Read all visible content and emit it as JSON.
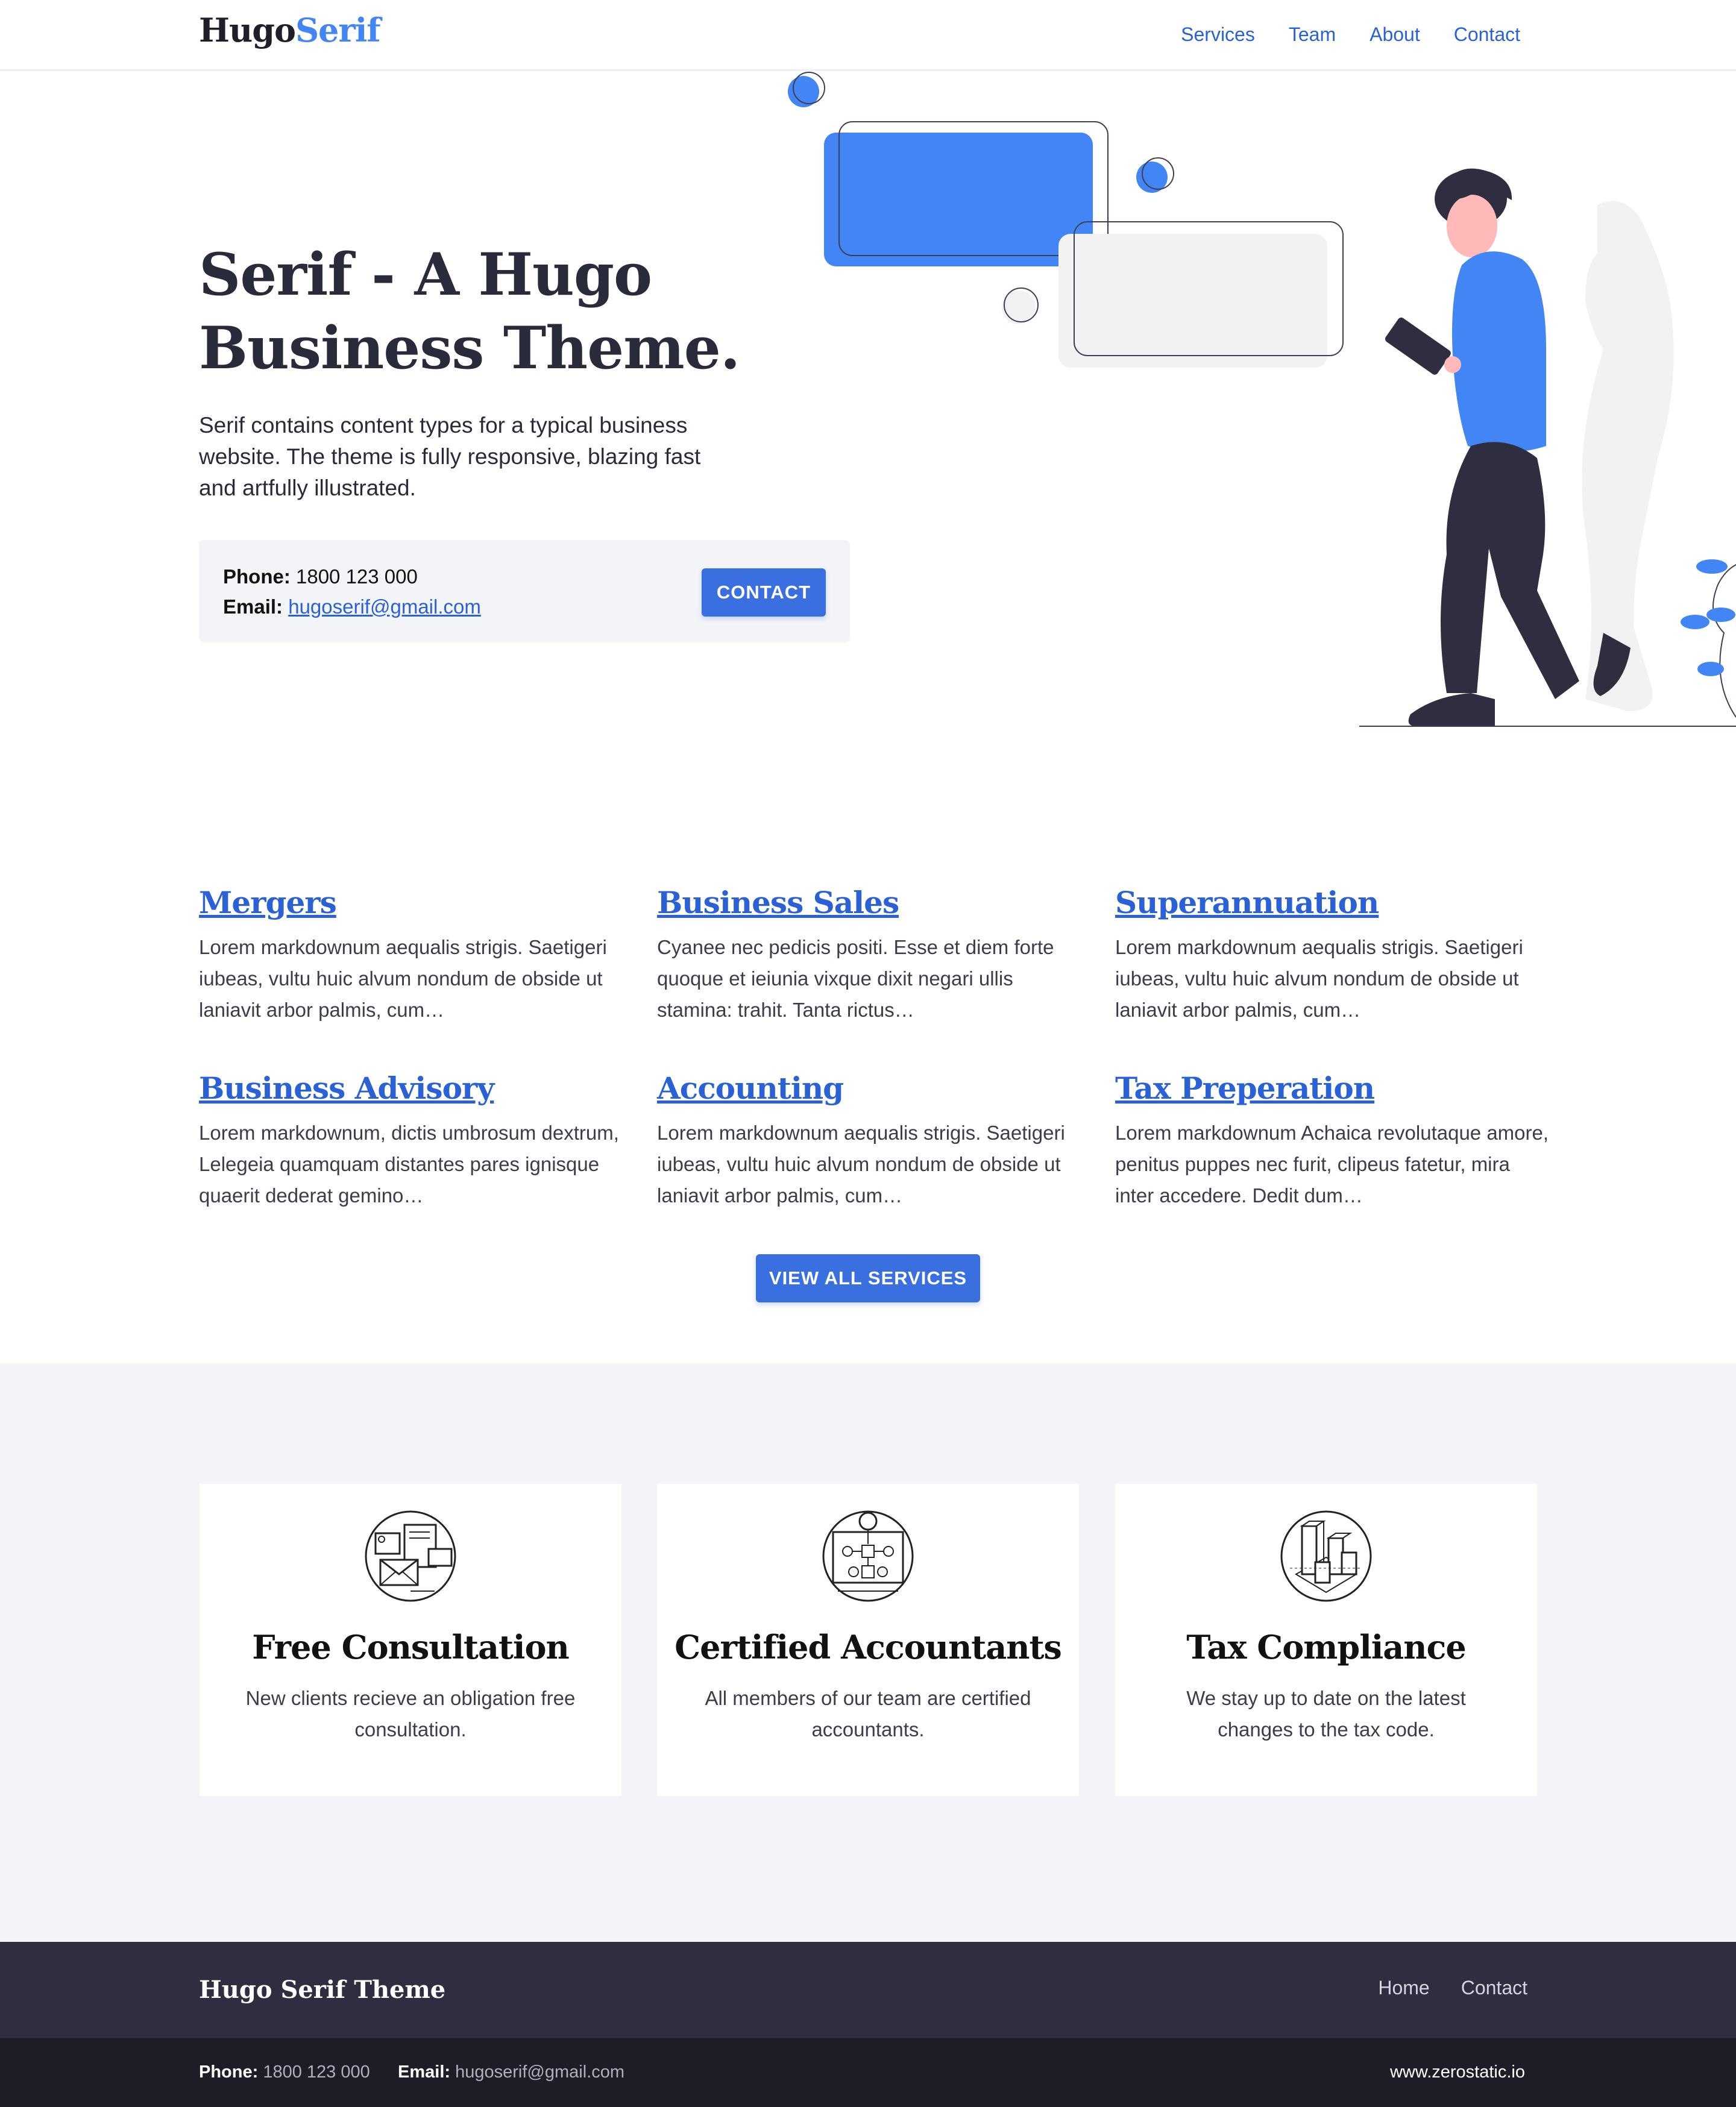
{
  "header": {
    "logo_part1": "Hugo",
    "logo_part2": "Serif",
    "nav": [
      "Services",
      "Team",
      "About",
      "Contact"
    ]
  },
  "hero": {
    "title_line1": "Serif - A Hugo",
    "title_line2": "Business Theme.",
    "description": "Serif contains content types for a typical business website. The theme is fully responsive, blazing fast and artfully illustrated.",
    "phone_label": "Phone:",
    "phone": "1800 123 000",
    "email_label": "Email:",
    "email": "hugoserif@gmail.com",
    "contact_button": "CONTACT",
    "illustration_icon": "person-with-tablet-illustration"
  },
  "services": {
    "items": [
      {
        "title": "Mergers",
        "text": "Lorem markdownum aequalis strigis. Saetigeri iubeas, vultu huic alvum nondum de obside ut laniavit arbor palmis, cum…"
      },
      {
        "title": "Business Sales",
        "text": "Cyanee nec pedicis positi. Esse et diem forte quoque et ieiunia vixque dixit negari ullis stamina: trahit. Tanta rictus…"
      },
      {
        "title": "Superannuation",
        "text": "Lorem markdownum aequalis strigis. Saetigeri iubeas, vultu huic alvum nondum de obside ut laniavit arbor palmis, cum…"
      },
      {
        "title": "Business Advisory",
        "text": "Lorem markdownum, dictis umbrosum dextrum, Lelegeia quamquam distantes pares ignisque quaerit dederat gemino…"
      },
      {
        "title": "Accounting",
        "text": "Lorem markdownum aequalis strigis. Saetigeri iubeas, vultu huic alvum nondum de obside ut laniavit arbor palmis, cum…"
      },
      {
        "title": "Tax Preperation",
        "text": "Lorem markdownum Achaica revolutaque amore, penitus puppes nec furit, clipeus fatetur, mira inter accedere. Dedit dum…"
      }
    ],
    "view_all_button": "VIEW ALL SERVICES"
  },
  "features": [
    {
      "title": "Free Consultation",
      "text": "New clients recieve an obligation free consultation.",
      "icon": "documents-icon"
    },
    {
      "title": "Certified Accountants",
      "text": "All members of our team are certified accountants.",
      "icon": "flowchart-lightbulb-icon"
    },
    {
      "title": "Tax Compliance",
      "text": "We stay up to date on the latest changes to the tax code.",
      "icon": "bar-blocks-icon"
    }
  ],
  "footer": {
    "title": "Hugo Serif Theme",
    "nav": [
      "Home",
      "Contact"
    ],
    "phone_label": "Phone:",
    "phone": "1800 123 000",
    "email_label": "Email:",
    "email": "hugoserif@gmail.com",
    "site": "www.zerostatic.io"
  },
  "colors": {
    "accent": "#4285f4",
    "link": "#2a61d6",
    "button": "#3a6fe0",
    "footer_top": "#2e2e40",
    "footer_bottom": "#1d1d28",
    "band": "#f3f4f8"
  }
}
